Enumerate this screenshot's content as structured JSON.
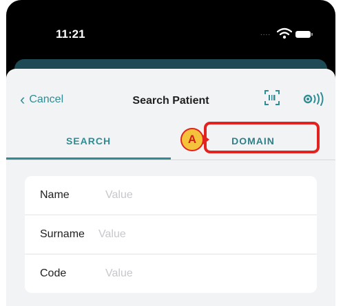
{
  "status_bar": {
    "time": "11:21",
    "signal": "....",
    "icons": [
      "wifi-icon",
      "battery-icon"
    ]
  },
  "nav": {
    "back_icon": "chevron-left-icon",
    "cancel_label": "Cancel",
    "title": "Search Patient",
    "action_icons": [
      "barcode-scan-icon",
      "nfc-icon"
    ]
  },
  "tabs": [
    {
      "label": "SEARCH",
      "selected": true
    },
    {
      "label": "DOMAIN",
      "selected": false
    }
  ],
  "annotation": {
    "marker": "A",
    "target": "DOMAIN"
  },
  "form": {
    "fields": [
      {
        "label": "Name",
        "placeholder": "Value",
        "value": ""
      },
      {
        "label": "Surname",
        "placeholder": "Value",
        "value": ""
      },
      {
        "label": "Code",
        "placeholder": "Value",
        "value": ""
      }
    ]
  },
  "colors": {
    "accent": "#2f8c95",
    "annotation": "#e2221f",
    "badge_fill": "#f5c33b",
    "sheet_bg": "#f2f3f5"
  }
}
